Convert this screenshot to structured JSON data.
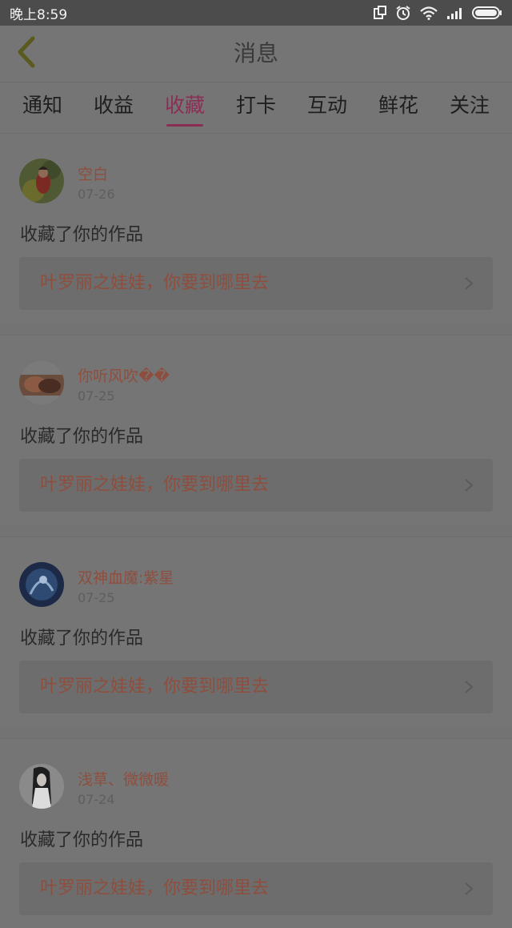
{
  "status_bar": {
    "time": "晚上8:59"
  },
  "header": {
    "title": "消息",
    "back_icon": "chevron-left-icon"
  },
  "tabs": [
    {
      "label": "通知",
      "active": false
    },
    {
      "label": "收益",
      "active": false
    },
    {
      "label": "收藏",
      "active": true
    },
    {
      "label": "打卡",
      "active": false
    },
    {
      "label": "互动",
      "active": false
    },
    {
      "label": "鲜花",
      "active": false
    },
    {
      "label": "关注",
      "active": false
    }
  ],
  "notifications": [
    {
      "user": "空白",
      "date": "07-26",
      "action": "收藏了你的作品",
      "work": "叶罗丽之娃娃，你要到哪里去"
    },
    {
      "user": "你听风吹��",
      "date": "07-25",
      "action": "收藏了你的作品",
      "work": "叶罗丽之娃娃，你要到哪里去"
    },
    {
      "user": "双神血魔:紫星",
      "date": "07-25",
      "action": "收藏了你的作品",
      "work": "叶罗丽之娃娃，你要到哪里去"
    },
    {
      "user": "浅草、微微暖",
      "date": "07-24",
      "action": "收藏了你的作品",
      "work": "叶罗丽之娃娃，你要到哪里去"
    }
  ],
  "colors": {
    "accent": "#8a2e55",
    "name_text": "#8e4e3e",
    "overlay_background": "#737373"
  }
}
